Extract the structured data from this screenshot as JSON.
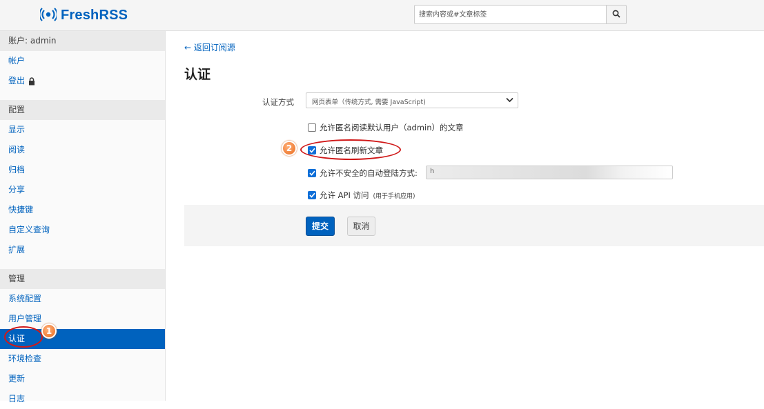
{
  "header": {
    "app_name": "FreshRSS",
    "search_placeholder": "搜索内容或#文章标签"
  },
  "sidebar": {
    "account_head": "账户: admin",
    "account_items": [
      "帐户",
      "登出"
    ],
    "config_head": "配置",
    "config_items": [
      "显示",
      "阅读",
      "归档",
      "分享",
      "快捷键",
      "自定义查询",
      "扩展"
    ],
    "admin_head": "管理",
    "admin_items": [
      "系统配置",
      "用户管理",
      "认证",
      "环境检查",
      "更新",
      "日志"
    ],
    "active_item": "认证"
  },
  "main": {
    "back_link": "← 返回订阅源",
    "title": "认证",
    "auth_method_label": "认证方式",
    "auth_method_value": "网页表单（传统方式, 需要 JavaScript)",
    "options": {
      "anon_read_label": "允许匿名阅读默认用户（admin）的文章",
      "anon_read_checked": false,
      "anon_refresh_label": "允许匿名刷新文章",
      "anon_refresh_checked": true,
      "unsafe_autologin_label": "允许不安全的自动登陆方式:",
      "unsafe_autologin_checked": true,
      "unsafe_autologin_value": "h",
      "api_label": "允许 API 访问",
      "api_note": "(用于手机应用)",
      "api_checked": true
    },
    "submit_label": "提交",
    "cancel_label": "取消"
  },
  "annotations": {
    "badge_1": "1",
    "badge_2": "2",
    "color": "#d01919",
    "badge_color": "#ea6b1c"
  },
  "colors": {
    "accent": "#0062be",
    "checkbox": "#0f6fd8"
  }
}
